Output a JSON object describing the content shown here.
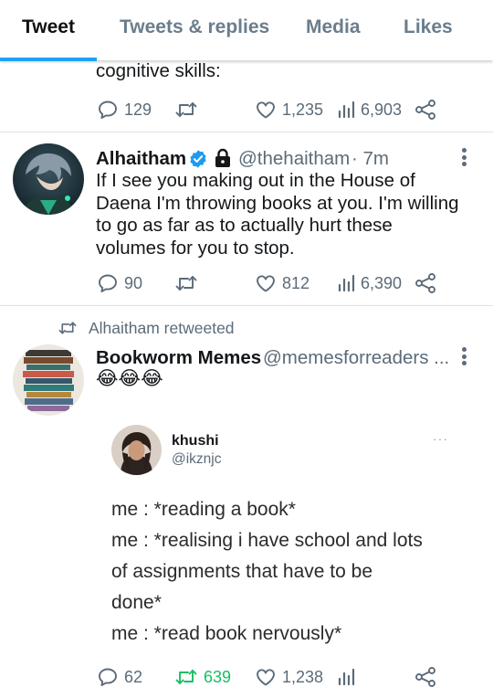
{
  "tabs": [
    {
      "label": "Tweet"
    },
    {
      "label": "Tweets & replies"
    },
    {
      "label": "Media"
    },
    {
      "label": "Likes"
    }
  ],
  "tweet1": {
    "text_tail": "cognitive skills:",
    "replies": "129",
    "likes": "1,235",
    "views": "6,903"
  },
  "tweet2": {
    "name": "Alhaitham",
    "handle": "@thehaitham",
    "time": "· 7m",
    "lines": [
      "If I see you making out in the House of",
      "Daena I'm throwing books at you. I'm willing",
      "to go as far as to actually hurt these",
      "volumes for you to stop."
    ],
    "replies": "90",
    "likes": "812",
    "views": "6,390"
  },
  "tweet3": {
    "retweeted_by": "Alhaitham retweeted",
    "name": "Bookworm Memes",
    "handle": "@memesforreaders ...",
    "emojis": "😂😂😂",
    "embedded": {
      "name": "khushi",
      "handle": "@ikznjc",
      "more": "···",
      "lines": [
        "me : *reading a book*",
        "me : *realising i have school and lots",
        "of assignments that have to be",
        "done*",
        "me : *read book nervously*"
      ]
    },
    "replies": "62",
    "retweets": "639",
    "likes": "1,238"
  },
  "colors": {
    "accent": "#1da1f2",
    "retweet_green": "#17bf63",
    "muted": "#5b6b79",
    "verified": "#1d9bf0"
  }
}
